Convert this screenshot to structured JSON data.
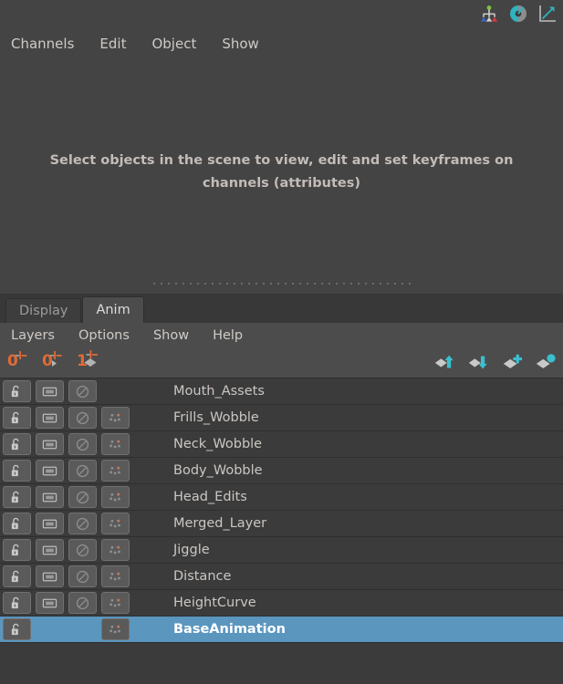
{
  "channel_box": {
    "menus": [
      {
        "label": "Channels"
      },
      {
        "label": "Edit"
      },
      {
        "label": "Object"
      },
      {
        "label": "Show"
      }
    ],
    "icons": [
      {
        "name": "channel-box-icon"
      },
      {
        "name": "attribute-editor-icon"
      },
      {
        "name": "graph-editor-icon"
      }
    ],
    "hint_text": "Select objects in the scene to view, edit and set keyframes on channels (attributes)"
  },
  "layer_editor": {
    "tabs": [
      {
        "label": "Display",
        "active": false
      },
      {
        "label": "Anim",
        "active": true
      }
    ],
    "menus": [
      {
        "label": "Layers"
      },
      {
        "label": "Options"
      },
      {
        "label": "Show"
      },
      {
        "label": "Help"
      }
    ],
    "key_nav": [
      {
        "name": "previous-key-button",
        "number": "0"
      },
      {
        "name": "current-key-button",
        "number": "0"
      },
      {
        "name": "next-key-button",
        "number": "1"
      }
    ],
    "actions": [
      {
        "name": "move-layer-up-button"
      },
      {
        "name": "move-layer-down-button"
      },
      {
        "name": "create-empty-layer-button"
      },
      {
        "name": "create-layer-from-selected-button"
      }
    ],
    "accent_orange": "#e06a35",
    "accent_teal": "#3bbfd0",
    "selection_blue": "#5b96bf",
    "layers": [
      {
        "name": "Mouth_Assets",
        "selected": false,
        "has_lock": true,
        "has_visibility": true,
        "has_mute": true,
        "has_keys": false
      },
      {
        "name": "Frills_Wobble",
        "selected": false,
        "has_lock": true,
        "has_visibility": true,
        "has_mute": true,
        "has_keys": true
      },
      {
        "name": "Neck_Wobble",
        "selected": false,
        "has_lock": true,
        "has_visibility": true,
        "has_mute": true,
        "has_keys": true
      },
      {
        "name": "Body_Wobble",
        "selected": false,
        "has_lock": true,
        "has_visibility": true,
        "has_mute": true,
        "has_keys": true
      },
      {
        "name": "Head_Edits",
        "selected": false,
        "has_lock": true,
        "has_visibility": true,
        "has_mute": true,
        "has_keys": true
      },
      {
        "name": "Merged_Layer",
        "selected": false,
        "has_lock": true,
        "has_visibility": true,
        "has_mute": true,
        "has_keys": true
      },
      {
        "name": "Jiggle",
        "selected": false,
        "has_lock": true,
        "has_visibility": true,
        "has_mute": true,
        "has_keys": true
      },
      {
        "name": "Distance",
        "selected": false,
        "has_lock": true,
        "has_visibility": true,
        "has_mute": true,
        "has_keys": true
      },
      {
        "name": "HeightCurve",
        "selected": false,
        "has_lock": true,
        "has_visibility": true,
        "has_mute": true,
        "has_keys": true
      },
      {
        "name": "BaseAnimation",
        "selected": true,
        "has_lock": true,
        "has_visibility": false,
        "has_mute": false,
        "has_keys": true
      }
    ]
  }
}
